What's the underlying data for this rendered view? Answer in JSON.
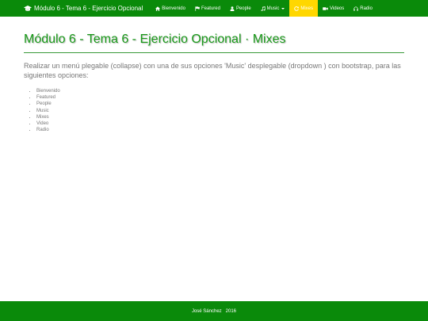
{
  "navbar": {
    "brand": "Módulo 6 - Tema 6 - Ejercicio Opcional",
    "brand_icon": "graduation-cap-icon",
    "items": [
      {
        "label": "Bienvenido",
        "icon": "home-icon"
      },
      {
        "label": "Featured",
        "icon": "flag-icon"
      },
      {
        "label": "People",
        "icon": "user-icon"
      },
      {
        "label": "Music",
        "icon": "music-icon",
        "dropdown": true
      },
      {
        "label": "Mixes",
        "icon": "refresh-icon",
        "active": true
      },
      {
        "label": "Videos",
        "icon": "video-icon"
      },
      {
        "label": "Radio",
        "icon": "headphones-icon"
      }
    ],
    "colors": {
      "background": "#0a8a0a",
      "active": "#ffd700",
      "text": "#ffffff"
    }
  },
  "main": {
    "title": "Módulo 6 - Tema 6 - Ejercicio Opcional · Mixes",
    "intro": "Realizar un menú plegable (collapse) con una de sus opciones 'Music' desplegable (dropdown ) con bootstrap, para las siguientes opciones:",
    "list": [
      "Bienvenido",
      "Featured",
      "People",
      "Music",
      "Mixes",
      "Video",
      "Radio"
    ],
    "title_color": "#1a9a1a"
  },
  "footer": {
    "text": "José Sánchez   2016"
  }
}
